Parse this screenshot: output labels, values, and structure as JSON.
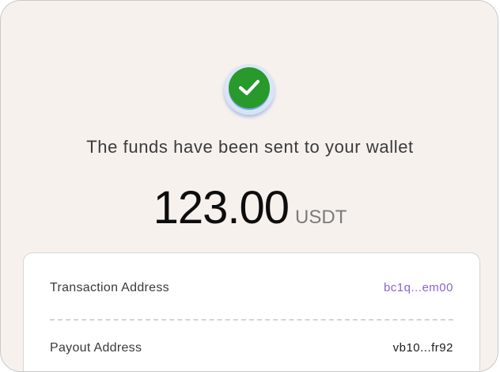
{
  "success_icon": "checkmark-circle-icon",
  "colors": {
    "success_green": "#289a2c",
    "address_purple": "#8a63d8",
    "background": "#f7f1ee"
  },
  "headline": "The funds have been sent to your wallet",
  "amount": {
    "value": "123.00",
    "currency": "USDT"
  },
  "details": {
    "rows": [
      {
        "label": "Transaction Address",
        "value": "bc1q...em00"
      },
      {
        "label": "Payout Address",
        "value": "vb10...fr92"
      }
    ]
  }
}
